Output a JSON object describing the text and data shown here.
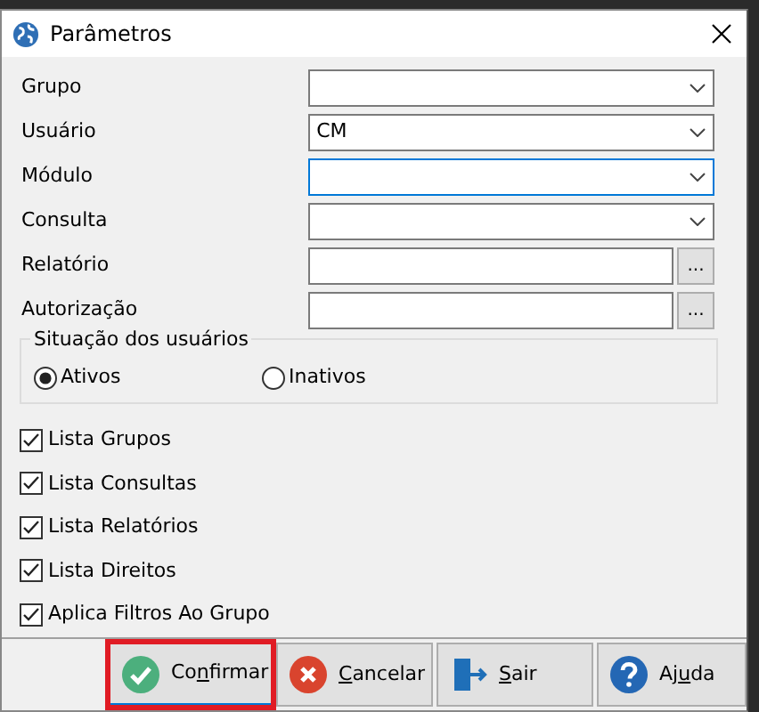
{
  "window": {
    "title": "Parâmetros"
  },
  "fields": [
    {
      "label": "Grupo",
      "kind": "dropdown",
      "focused": false
    },
    {
      "label": "Usuário",
      "kind": "dropdown",
      "value": "CM",
      "focused": false
    },
    {
      "label": "Módulo",
      "kind": "dropdown",
      "focused": true
    },
    {
      "label": "Consulta",
      "kind": "dropdown",
      "focused": false
    },
    {
      "label": "Relatório",
      "kind": "lookup",
      "focused": false,
      "button": "..."
    },
    {
      "label": "Autorização",
      "kind": "lookup",
      "focused": false,
      "button": "..."
    }
  ],
  "user_status": {
    "legend": "Situação dos usuários",
    "options": [
      {
        "label": "Ativos",
        "selected": true
      },
      {
        "label": "Inativos",
        "selected": false
      }
    ]
  },
  "checkboxes": [
    {
      "label": "Lista Grupos",
      "checked": true
    },
    {
      "label": "Lista Consultas",
      "checked": true
    },
    {
      "label": "Lista Relatórios",
      "checked": true
    },
    {
      "label": "Lista Direitos",
      "checked": true
    },
    {
      "label": "Aplica Filtros Ao Grupo",
      "checked": true
    }
  ],
  "buttons": [
    {
      "kind": "confirm",
      "before": "Co",
      "key": "n",
      "after": "firmar",
      "highlighted": true
    },
    {
      "kind": "cancel",
      "key": "C",
      "after": "ancelar",
      "highlighted": false
    },
    {
      "kind": "exit",
      "key": "S",
      "after": "air",
      "highlighted": false
    },
    {
      "kind": "help",
      "before": "Aj",
      "key": "u",
      "after": "da",
      "highlighted": false
    }
  ]
}
